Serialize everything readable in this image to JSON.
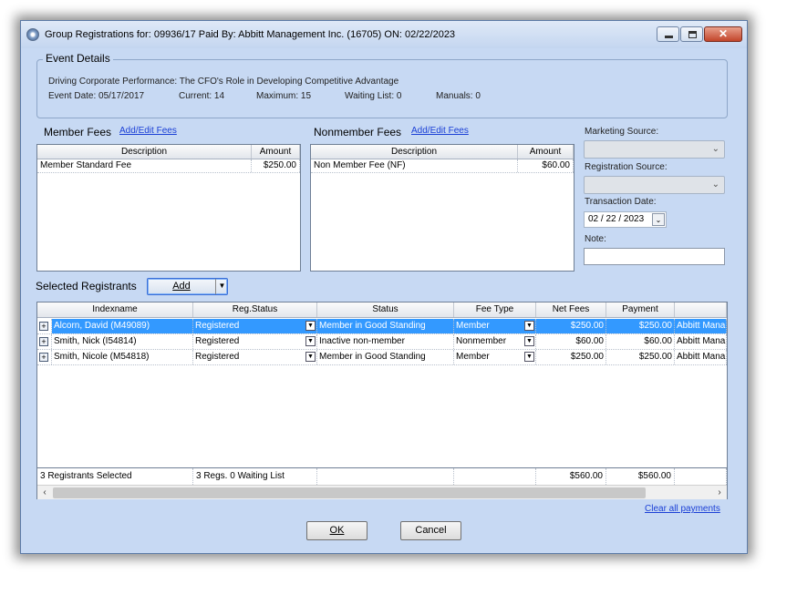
{
  "window": {
    "title": "Group Registrations for: 09936/17 Paid By: Abbitt Management Inc. (16705)  ON: 02/22/2023",
    "close_glyph": "✕"
  },
  "event": {
    "legend": "Event Details",
    "name": "Driving Corporate Performance: The CFO's Role in Developing Competitive Advantage",
    "date": "Event Date: 05/17/2017",
    "current": "Current: 14",
    "maximum": "Maximum: 15",
    "waiting": "Waiting List: 0",
    "manuals": "Manuals: 0"
  },
  "member_fees": {
    "label": "Member Fees",
    "link": "Add/Edit Fees",
    "headers": [
      "Description",
      "Amount"
    ],
    "rows": [
      {
        "description": "Member Standard Fee",
        "amount": "$250.00"
      }
    ]
  },
  "nonmember_fees": {
    "label": "Nonmember Fees",
    "link": "Add/Edit Fees",
    "headers": [
      "Description",
      "Amount"
    ],
    "rows": [
      {
        "description": "Non Member Fee (NF)",
        "amount": "$60.00"
      }
    ]
  },
  "side": {
    "marketing_label": "Marketing Source:",
    "registration_label": "Registration Source:",
    "transaction_label": "Transaction Date:",
    "transaction_value": "02 / 22 / 2023",
    "note_label": "Note:"
  },
  "registrants": {
    "label": "Selected Registrants",
    "add_label": "Add",
    "headers": [
      "Indexname",
      "Reg.Status",
      "Status",
      "Fee Type",
      "Net Fees",
      "Payment",
      ""
    ],
    "rows": [
      {
        "name": "Alcorn, David (M49089)",
        "reg_status": "Registered",
        "status": "Member in Good Standing",
        "fee_type": "Member",
        "net": "$250.00",
        "payment": "$250.00",
        "paid_by": "Abbitt Mana"
      },
      {
        "name": "Smith, Nick (I54814)",
        "reg_status": "Registered",
        "status": "Inactive non-member",
        "fee_type": "Nonmember",
        "net": "$60.00",
        "payment": "$60.00",
        "paid_by": "Abbitt Mana"
      },
      {
        "name": "Smith, Nicole (M54818)",
        "reg_status": "Registered",
        "status": "Member in Good Standing",
        "fee_type": "Member",
        "net": "$250.00",
        "payment": "$250.00",
        "paid_by": "Abbitt Mana"
      }
    ],
    "footer": {
      "selected": "3 Registrants Selected",
      "regs": "3 Regs.  0 Waiting List",
      "net": "$560.00",
      "payment": "$560.00"
    }
  },
  "clear_payments": "Clear all payments",
  "ok_label": "OK",
  "cancel_label": "Cancel"
}
